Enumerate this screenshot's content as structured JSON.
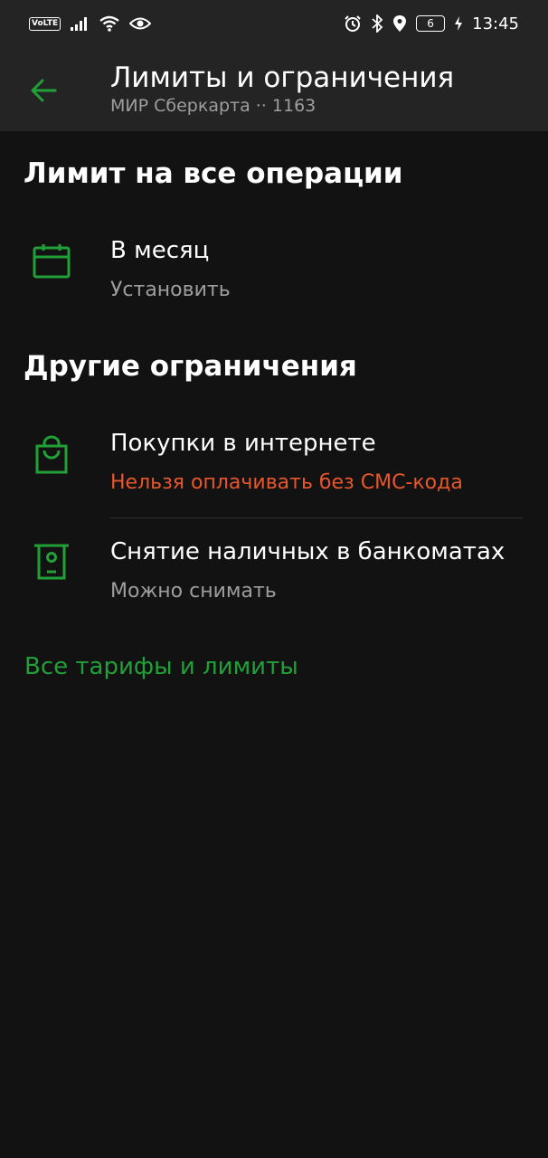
{
  "status_bar": {
    "volte": "VoLTE",
    "battery": "6",
    "time": "13:45"
  },
  "header": {
    "title": "Лимиты и ограничения",
    "subtitle": "МИР Сберкарта ·· 1163"
  },
  "sections": {
    "limits_title": "Лимит на все операции",
    "other_title": "Другие ограничения"
  },
  "rows": [
    {
      "title": "В месяц",
      "subtitle": "Установить",
      "icon": "calendar-icon"
    },
    {
      "title": "Покупки в интернете",
      "subtitle": "Нельзя оплачивать без СМС-кода",
      "icon": "shopping-bag-icon"
    },
    {
      "title": "Снятие наличных в банкоматах",
      "subtitle": "Можно снимать",
      "icon": "atm-icon"
    }
  ],
  "link": "Все тарифы и лимиты",
  "colors": {
    "accent": "#21a038",
    "warning": "#e8572c",
    "muted": "#9e9e9e",
    "header_bg": "#242424",
    "background": "#121212"
  }
}
